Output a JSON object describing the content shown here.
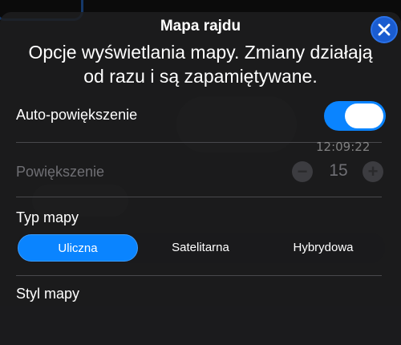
{
  "header": {
    "title": "Mapa rajdu",
    "description": "Opcje wyświetlania mapy. Zmiany działają od razu i są zapamiętywane.",
    "close_icon": "close-icon"
  },
  "background": {
    "time_text": "12:09:22"
  },
  "settings": {
    "auto_zoom": {
      "label": "Auto-powiększenie",
      "enabled": true
    },
    "zoom": {
      "label": "Powiększenie",
      "value": "15",
      "minus_icon": "minus-icon",
      "plus_icon": "plus-icon",
      "disabled": true
    },
    "map_type": {
      "label": "Typ mapy",
      "options": [
        "Uliczna",
        "Satelitarna",
        "Hybrydowa"
      ],
      "selected": "Uliczna"
    },
    "map_style": {
      "label": "Styl mapy"
    }
  },
  "colors": {
    "accent": "#0a84ff",
    "panel_bg": "#1e1e20",
    "disabled_text": "#6f6f74"
  }
}
